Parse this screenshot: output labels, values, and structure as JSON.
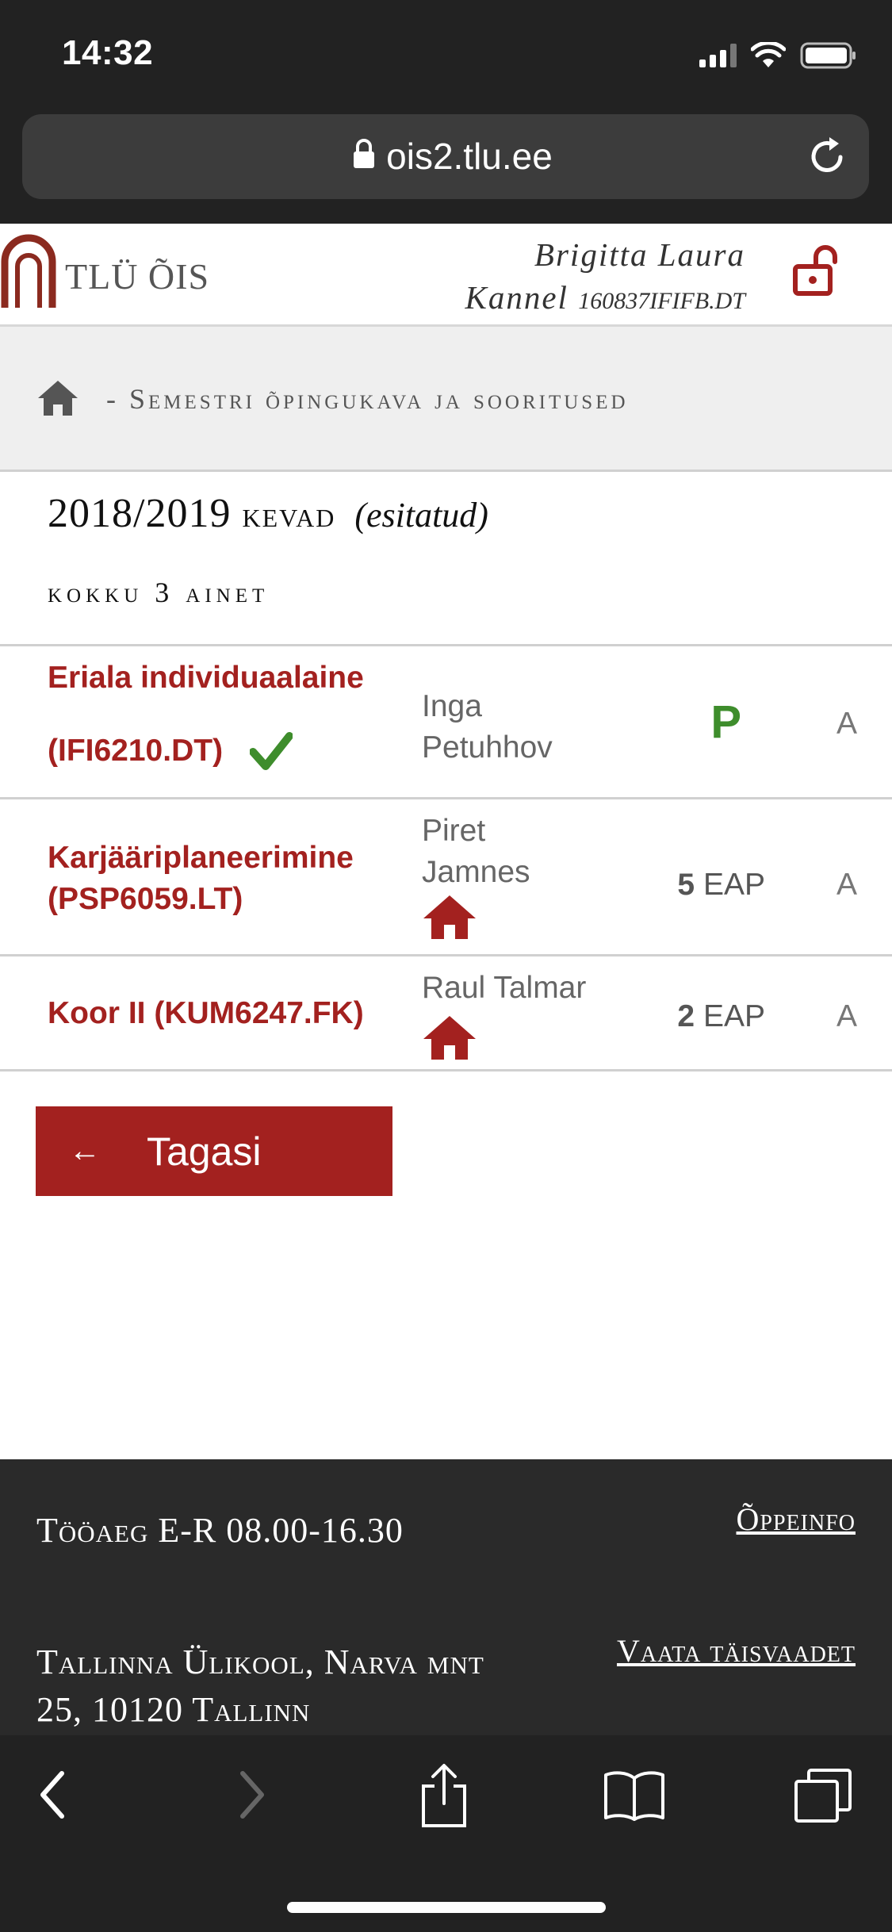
{
  "status_bar": {
    "time": "14:32"
  },
  "browser": {
    "url": "ois2.tlu.ee"
  },
  "header": {
    "logo_text": "TLÜ ÕIS",
    "user_name_line1": "Brigitta Laura",
    "user_name_line2": "Kannel",
    "user_code": "160837IFIFB.DT"
  },
  "breadcrumb": {
    "separator": "-",
    "text": "Semestri õpingukava ja sooritused"
  },
  "semester": {
    "year": "2018/2019",
    "season": "kevad",
    "status": "(esitatud)",
    "count_text": "kokku 3 ainet"
  },
  "courses": [
    {
      "name_line1": "Eriala individuaalaine",
      "name_line2": "(IFI6210.DT)",
      "teacher_line1": "Inga",
      "teacher_line2": "Petuhhov",
      "result": "P",
      "grade": "A"
    },
    {
      "name_line1": "Karjääriplaneerimine",
      "name_line2": "(PSP6059.LT)",
      "teacher_line1": "Piret",
      "teacher_line2": "Jamnes",
      "credits_num": "5",
      "credits_unit": "EAP",
      "grade": "A"
    },
    {
      "name_line1": "Koor II (KUM6247.FK)",
      "teacher_line1": "Raul Talmar",
      "credits_num": "2",
      "credits_unit": "EAP",
      "grade": "A"
    }
  ],
  "back_button": {
    "arrow": "←",
    "label": "Tagasi"
  },
  "footer": {
    "hours": "Tööaeg E-R 08.00-16.30",
    "address_line1": "Tallinna Ülikool, Narva mnt",
    "address_line2": "25, 10120 Tallinn",
    "link_study_info": "Õppeinfo",
    "link_full_view": "Vaata täisvaadet"
  },
  "colors": {
    "accent": "#a3211f",
    "success": "#3e8d2c",
    "dark_bar": "#222222"
  }
}
